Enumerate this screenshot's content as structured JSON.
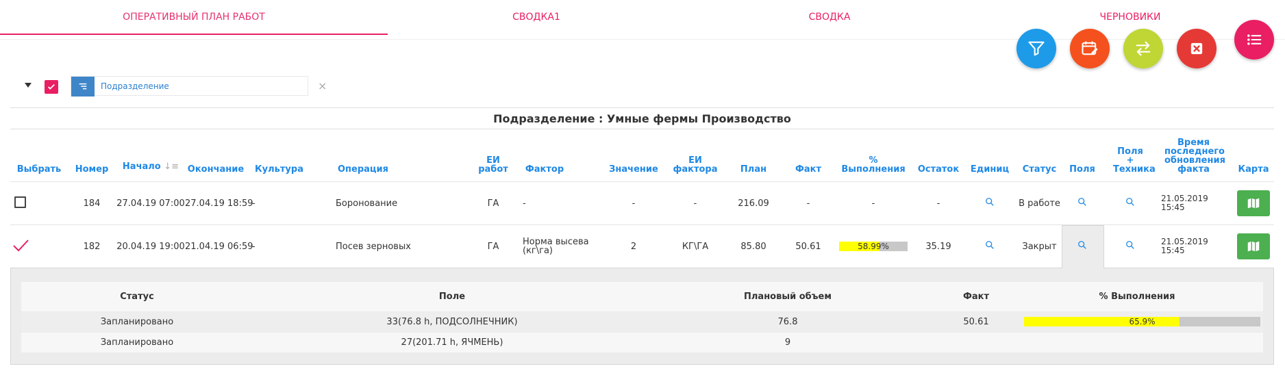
{
  "tabs": [
    {
      "label": "ОПЕРАТИВНЫЙ ПЛАН РАБОТ",
      "active": true
    },
    {
      "label": "СВОДКА1",
      "active": false
    },
    {
      "label": "СВОДКА",
      "active": false
    },
    {
      "label": "ЧЕРНОВИКИ",
      "active": false
    }
  ],
  "fabs": [
    {
      "name": "filter",
      "color": "#1e9be8"
    },
    {
      "name": "calendar-edit",
      "color": "#f4511e"
    },
    {
      "name": "swap-arrows",
      "color": "#c0d634"
    },
    {
      "name": "close",
      "color": "#e53935"
    },
    {
      "name": "list-menu",
      "color": "#e91e63"
    }
  ],
  "grouping": {
    "label": "Подразделение",
    "clear": "×"
  },
  "group_header": "Подразделение : Умные фермы Производство",
  "columns": {
    "select": "Выбрать",
    "number": "Номер",
    "start": "Начало",
    "end": "Окончание",
    "culture": "Культура",
    "operation": "Операция",
    "unit_work": "ЕИ работ",
    "factor": "Фактор",
    "value": "Значение",
    "unit_factor": "ЕИ фактора",
    "plan": "План",
    "fact": "Факт",
    "percent": "% Выполнения",
    "rest": "Остаток",
    "units": "Единиц",
    "status": "Статус",
    "fields": "Поля",
    "fields_tech": "Поля + Техника",
    "last_update": "Время последнего обновления факта",
    "map": "Карта"
  },
  "rows": [
    {
      "checked": false,
      "number": "184",
      "start": "27.04.19 07:00",
      "end": "27.04.19 18:59",
      "culture": "-",
      "operation": "Боронование",
      "unit_work": "ГА",
      "factor": "-",
      "value": "-",
      "unit_factor": "-",
      "plan": "216.09",
      "fact": "-",
      "percent": "-",
      "percent_value": null,
      "rest": "-",
      "status": "В работе",
      "last_update_date": "21.05.2019",
      "last_update_time": "15:45"
    },
    {
      "checked": true,
      "number": "182",
      "start": "20.04.19 19:00",
      "end": "21.04.19 06:59",
      "culture": "-",
      "operation": "Посев зерновых",
      "unit_work": "ГА",
      "factor": "Норма высева (кг\\га)",
      "value": "2",
      "unit_factor": "КГ\\ГА",
      "plan": "85.80",
      "fact": "50.61",
      "percent": "58.99%",
      "percent_value": 0.5899,
      "rest": "35.19",
      "status": "Закрыт",
      "last_update_date": "21.05.2019",
      "last_update_time": "15:45"
    }
  ],
  "detail": {
    "columns": {
      "status": "Статус",
      "field": "Поле",
      "plan_volume": "Плановый объем",
      "fact": "Факт",
      "percent": "% Выполнения"
    },
    "rows": [
      {
        "status": "Запланировано",
        "field": "33(76.8 h, ПОДСОЛНЕЧНИК)",
        "plan_volume": "76.8",
        "fact": "50.61",
        "percent": "65.9%",
        "percent_value": 0.659
      },
      {
        "status": "Запланировано",
        "field": "27(201.71 h, ЯЧМЕНЬ)",
        "plan_volume": "9",
        "fact": "",
        "percent": "",
        "percent_value": null
      }
    ]
  }
}
